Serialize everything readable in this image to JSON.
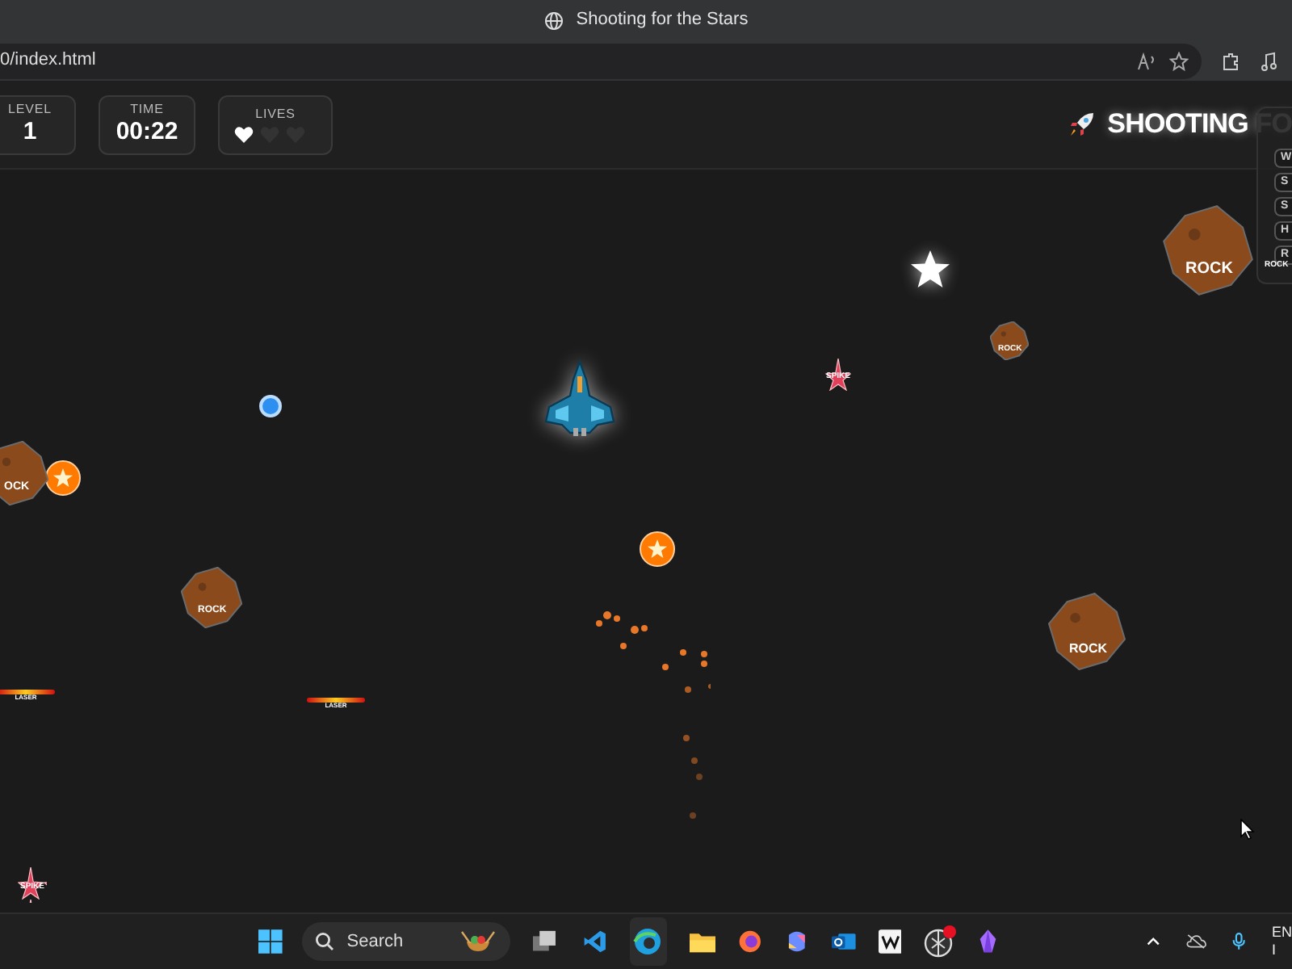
{
  "browser": {
    "tab_title": "Shooting for the Stars",
    "address": "0/index.html"
  },
  "hud": {
    "stats": [
      {
        "label": "LEVEL",
        "value": "1"
      },
      {
        "label": "TIME",
        "value": "00:22"
      }
    ],
    "lives": {
      "label": "LIVES",
      "hearts": [
        {
          "filled": true
        },
        {
          "filled": false
        },
        {
          "filled": false
        }
      ]
    },
    "title": "SHOOTING FO"
  },
  "side_panel": {
    "keys": [
      "W",
      "S",
      "S",
      "H",
      "R"
    ]
  },
  "game": {
    "objects": [
      {
        "kind": "rock",
        "label": "ROCK"
      },
      {
        "kind": "tag",
        "label": "ROCK"
      },
      {
        "kind": "star"
      },
      {
        "kind": "rock",
        "label": "ROCK"
      },
      {
        "kind": "shield"
      },
      {
        "kind": "ship"
      },
      {
        "kind": "spike",
        "label": "SPIKE"
      },
      {
        "kind": "rock",
        "label": "ROCK"
      },
      {
        "kind": "powerup"
      },
      {
        "kind": "powerup"
      },
      {
        "kind": "rock",
        "label": "ROCK"
      },
      {
        "kind": "rock",
        "label": "OCK"
      },
      {
        "kind": "laser",
        "label": "LASER"
      },
      {
        "kind": "laser",
        "label": "LASER"
      },
      {
        "kind": "spike",
        "label": "SPIKE"
      }
    ]
  },
  "taskbar": {
    "search": "Search",
    "language": "EN",
    "language_2": "I"
  }
}
